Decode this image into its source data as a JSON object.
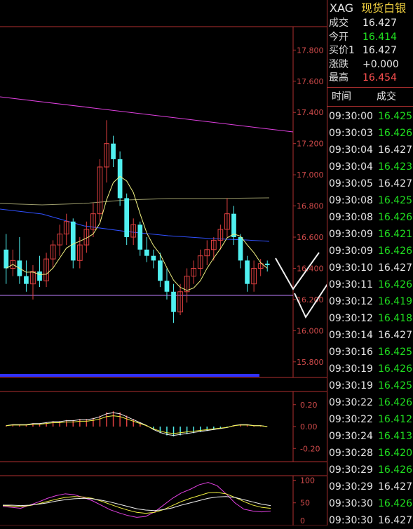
{
  "header": {
    "symbol": "XAG",
    "name": "现货白银"
  },
  "quote": [
    {
      "label": "成交",
      "value": "16.427",
      "color": "#e6e6e6"
    },
    {
      "label": "今开",
      "value": "16.414",
      "color": "#20e020"
    },
    {
      "label": "买价1",
      "value": "16.427",
      "color": "#e6e6e6"
    },
    {
      "label": "涨跌",
      "value": "+0.000",
      "color": "#e6e6e6"
    },
    {
      "label": "最高",
      "value": "16.454",
      "color": "#ff5050"
    }
  ],
  "ticks_header": {
    "time": "时间",
    "price": "成交"
  },
  "ticks": [
    {
      "time": "09:30:00",
      "price": "16.425",
      "color": "#20e020"
    },
    {
      "time": "09:30:03",
      "price": "16.426",
      "color": "#20e020"
    },
    {
      "time": "09:30:04",
      "price": "16.427",
      "color": "#e6e6e6"
    },
    {
      "time": "09:30:04",
      "price": "16.423",
      "color": "#20e020"
    },
    {
      "time": "09:30:05",
      "price": "16.427",
      "color": "#e6e6e6"
    },
    {
      "time": "09:30:08",
      "price": "16.425",
      "color": "#20e020"
    },
    {
      "time": "09:30:08",
      "price": "16.426",
      "color": "#20e020"
    },
    {
      "time": "09:30:09",
      "price": "16.421",
      "color": "#20e020"
    },
    {
      "time": "09:30:09",
      "price": "16.426",
      "color": "#20e020"
    },
    {
      "time": "09:30:10",
      "price": "16.427",
      "color": "#e6e6e6"
    },
    {
      "time": "09:30:11",
      "price": "16.426",
      "color": "#20e020"
    },
    {
      "time": "09:30:12",
      "price": "16.419",
      "color": "#20e020"
    },
    {
      "time": "09:30:12",
      "price": "16.418",
      "color": "#20e020"
    },
    {
      "time": "09:30:14",
      "price": "16.427",
      "color": "#e6e6e6"
    },
    {
      "time": "09:30:16",
      "price": "16.425",
      "color": "#20e020"
    },
    {
      "time": "09:30:19",
      "price": "16.426",
      "color": "#20e020"
    },
    {
      "time": "09:30:19",
      "price": "16.425",
      "color": "#20e020"
    },
    {
      "time": "09:30:22",
      "price": "16.426",
      "color": "#20e020"
    },
    {
      "time": "09:30:22",
      "price": "16.412",
      "color": "#20e020"
    },
    {
      "time": "09:30:24",
      "price": "16.413",
      "color": "#20e020"
    },
    {
      "time": "09:30:28",
      "price": "16.420",
      "color": "#20e020"
    },
    {
      "time": "09:30:29",
      "price": "16.426",
      "color": "#20e020"
    },
    {
      "time": "09:30:29",
      "price": "16.427",
      "color": "#e6e6e6"
    },
    {
      "time": "09:30:30",
      "price": "16.426",
      "color": "#20e020"
    },
    {
      "time": "09:30:30",
      "price": "16.427",
      "color": "#e6e6e6"
    }
  ],
  "chart_data": [
    {
      "type": "candlestick",
      "y_ticks": [
        "17.800",
        "17.600",
        "17.400",
        "17.200",
        "17.000",
        "16.800",
        "16.600",
        "16.400",
        "16.200",
        "16.000",
        "15.800"
      ],
      "ylim": [
        15.7,
        17.95
      ],
      "candles": [
        [
          16.52,
          16.62,
          16.3,
          16.4
        ],
        [
          16.4,
          16.52,
          16.35,
          16.45
        ],
        [
          16.45,
          16.6,
          16.3,
          16.35
        ],
        [
          16.35,
          16.45,
          16.25,
          16.3
        ],
        [
          16.3,
          16.42,
          16.2,
          16.38
        ],
        [
          16.38,
          16.48,
          16.28,
          16.32
        ],
        [
          16.32,
          16.5,
          16.28,
          16.46
        ],
        [
          16.46,
          16.58,
          16.4,
          16.55
        ],
        [
          16.55,
          16.68,
          16.48,
          16.62
        ],
        [
          16.62,
          16.75,
          16.55,
          16.7
        ],
        [
          16.7,
          16.72,
          16.4,
          16.45
        ],
        [
          16.45,
          16.6,
          16.4,
          16.55
        ],
        [
          16.55,
          16.7,
          16.5,
          16.65
        ],
        [
          16.65,
          16.82,
          16.6,
          16.75
        ],
        [
          16.75,
          17.1,
          16.7,
          17.05
        ],
        [
          17.05,
          17.35,
          16.95,
          17.2
        ],
        [
          17.2,
          17.25,
          17.05,
          17.1
        ],
        [
          17.1,
          17.15,
          16.8,
          16.85
        ],
        [
          16.85,
          16.88,
          16.55,
          16.6
        ],
        [
          16.6,
          16.72,
          16.55,
          16.68
        ],
        [
          16.68,
          16.7,
          16.48,
          16.52
        ],
        [
          16.52,
          16.6,
          16.44,
          16.48
        ],
        [
          16.48,
          16.52,
          16.4,
          16.45
        ],
        [
          16.45,
          16.5,
          16.28,
          16.32
        ],
        [
          16.32,
          16.4,
          16.2,
          16.25
        ],
        [
          16.25,
          16.3,
          16.05,
          16.12
        ],
        [
          16.12,
          16.3,
          16.1,
          16.25
        ],
        [
          16.25,
          16.4,
          16.18,
          16.35
        ],
        [
          16.35,
          16.45,
          16.3,
          16.4
        ],
        [
          16.4,
          16.52,
          16.35,
          16.48
        ],
        [
          16.48,
          16.58,
          16.42,
          16.52
        ],
        [
          16.52,
          16.6,
          16.45,
          16.58
        ],
        [
          16.58,
          16.68,
          16.52,
          16.65
        ],
        [
          16.65,
          16.85,
          16.6,
          16.75
        ],
        [
          16.75,
          16.8,
          16.55,
          16.6
        ],
        [
          16.6,
          16.62,
          16.4,
          16.45
        ],
        [
          16.45,
          16.48,
          16.25,
          16.3
        ],
        [
          16.3,
          16.45,
          16.25,
          16.4
        ],
        [
          16.4,
          16.46,
          16.35,
          16.43
        ],
        [
          16.43,
          16.45,
          16.38,
          16.42
        ]
      ]
    },
    {
      "type": "bar",
      "y_ticks": [
        "0.20",
        "0.00",
        "-0.20"
      ],
      "ylim": [
        -0.32,
        0.32
      ],
      "values": [
        0.01,
        0.02,
        0.02,
        0.02,
        0.03,
        0.03,
        0.04,
        0.05,
        0.05,
        0.06,
        0.06,
        0.07,
        0.07,
        0.08,
        0.1,
        0.13,
        0.14,
        0.13,
        0.1,
        0.07,
        0.04,
        0.01,
        -0.03,
        -0.06,
        -0.08,
        -0.09,
        -0.08,
        -0.07,
        -0.06,
        -0.05,
        -0.04,
        -0.03,
        -0.02,
        -0.01,
        0.01,
        0.02,
        0.02,
        0.01,
        0.01,
        0.0
      ]
    },
    {
      "type": "line",
      "y_ticks": [
        "100",
        "50",
        "0"
      ],
      "ylim": [
        0,
        110
      ],
      "series": [
        {
          "color": "#e040e0",
          "values": [
            42,
            40,
            38,
            45,
            52,
            60,
            66,
            70,
            68,
            62,
            55,
            45,
            35,
            28,
            22,
            18,
            20,
            30,
            45,
            60,
            72,
            80,
            90,
            95,
            88,
            70,
            50,
            36,
            32,
            30,
            32
          ]
        },
        {
          "color": "#f0f040",
          "values": [
            44,
            43,
            42,
            44,
            48,
            53,
            58,
            62,
            64,
            63,
            60,
            54,
            47,
            40,
            34,
            29,
            27,
            29,
            35,
            44,
            53,
            60,
            66,
            72,
            73,
            70,
            62,
            53,
            45,
            40,
            38
          ]
        },
        {
          "color": "#f0f0f0",
          "values": [
            45,
            45,
            44,
            45,
            47,
            50,
            54,
            57,
            59,
            60,
            59,
            56,
            52,
            47,
            42,
            37,
            34,
            33,
            35,
            39,
            45,
            50,
            55,
            60,
            63,
            64,
            62,
            57,
            52,
            47,
            44
          ]
        }
      ]
    }
  ]
}
